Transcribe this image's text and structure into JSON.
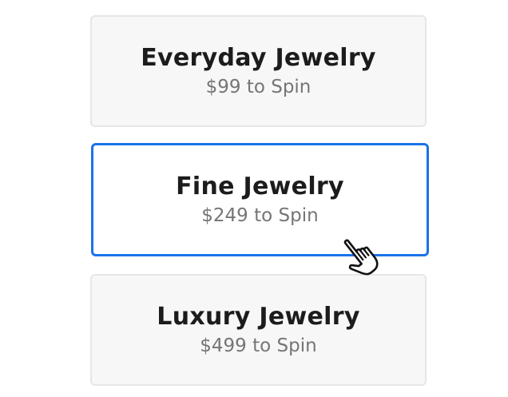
{
  "options": [
    {
      "title": "Everyday Jewelry",
      "price": "$99 to Spin",
      "selected": false
    },
    {
      "title": "Fine Jewelry",
      "price": "$249 to Spin",
      "selected": true
    },
    {
      "title": "Luxury Jewelry",
      "price": "$499 to Spin",
      "selected": false
    }
  ],
  "colors": {
    "selected_border": "#1a73e8",
    "card_background": "#f7f7f7",
    "card_border": "#e6e6e6",
    "title_text": "#1c1c1c",
    "price_text": "#757575"
  },
  "cursor": {
    "icon": "hand-pointer-icon"
  }
}
